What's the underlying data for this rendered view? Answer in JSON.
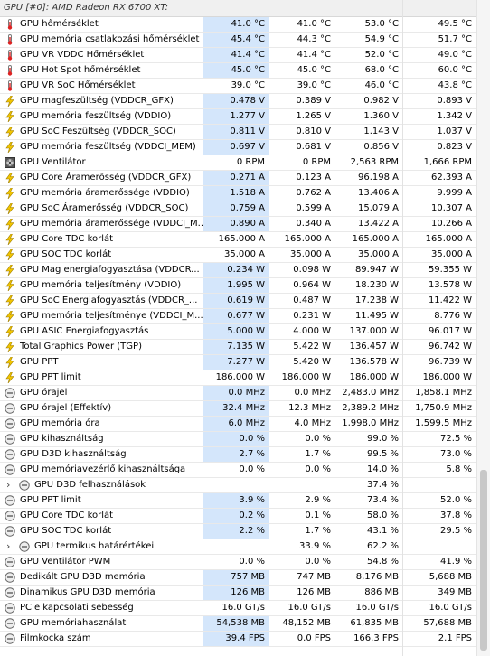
{
  "header": {
    "title": "GPU [#0]: AMD Radeon RX 6700 XT:"
  },
  "rows": [
    {
      "icon": "thermometer-icon",
      "label": "GPU hőmérséklet",
      "cur": "41.0 °C",
      "min": "41.0 °C",
      "max": "53.0 °C",
      "avg": "49.5 °C",
      "hl": true
    },
    {
      "icon": "thermometer-icon",
      "label": "GPU memória csatlakozási hőmérséklet",
      "cur": "45.4 °C",
      "min": "44.3 °C",
      "max": "54.9 °C",
      "avg": "51.7 °C",
      "hl": true
    },
    {
      "icon": "thermometer-icon",
      "label": "GPU VR VDDC Hőmérséklet",
      "cur": "41.4 °C",
      "min": "41.4 °C",
      "max": "52.0 °C",
      "avg": "49.0 °C",
      "hl": true
    },
    {
      "icon": "thermometer-icon",
      "label": "GPU Hot Spot hőmérséklet",
      "cur": "45.0 °C",
      "min": "45.0 °C",
      "max": "68.0 °C",
      "avg": "60.0 °C",
      "hl": true
    },
    {
      "icon": "thermometer-icon",
      "label": "GPU VR SoC Hőmérséklet",
      "cur": "39.0 °C",
      "min": "39.0 °C",
      "max": "46.0 °C",
      "avg": "43.8 °C",
      "hl": false
    },
    {
      "icon": "lightning-icon",
      "label": "GPU magfeszültség (VDDCR_GFX)",
      "cur": "0.478 V",
      "min": "0.389 V",
      "max": "0.982 V",
      "avg": "0.893 V",
      "hl": true
    },
    {
      "icon": "lightning-icon",
      "label": "GPU memória feszültség (VDDIO)",
      "cur": "1.277 V",
      "min": "1.265 V",
      "max": "1.360 V",
      "avg": "1.342 V",
      "hl": true
    },
    {
      "icon": "lightning-icon",
      "label": "GPU SoC Feszültség (VDDCR_SOC)",
      "cur": "0.811 V",
      "min": "0.810 V",
      "max": "1.143 V",
      "avg": "1.037 V",
      "hl": true
    },
    {
      "icon": "lightning-icon",
      "label": "GPU memória feszültség (VDDCI_MEM)",
      "cur": "0.697 V",
      "min": "0.681 V",
      "max": "0.856 V",
      "avg": "0.823 V",
      "hl": true
    },
    {
      "icon": "fan-icon",
      "label": "GPU Ventilátor",
      "cur": "0 RPM",
      "min": "0 RPM",
      "max": "2,563 RPM",
      "avg": "1,666 RPM",
      "hl": false
    },
    {
      "icon": "lightning-icon",
      "label": "GPU Core Áramerősség (VDDCR_GFX)",
      "cur": "0.271 A",
      "min": "0.123 A",
      "max": "96.198 A",
      "avg": "62.393 A",
      "hl": true
    },
    {
      "icon": "lightning-icon",
      "label": "GPU memória áramerőssége (VDDIO)",
      "cur": "1.518 A",
      "min": "0.762 A",
      "max": "13.406 A",
      "avg": "9.999 A",
      "hl": true
    },
    {
      "icon": "lightning-icon",
      "label": "GPU SoC Áramerősség (VDDCR_SOC)",
      "cur": "0.759 A",
      "min": "0.599 A",
      "max": "15.079 A",
      "avg": "10.307 A",
      "hl": true
    },
    {
      "icon": "lightning-icon",
      "label": "GPU memória áramerőssége (VDDCI_M...",
      "cur": "0.890 A",
      "min": "0.340 A",
      "max": "13.422 A",
      "avg": "10.266 A",
      "hl": true
    },
    {
      "icon": "lightning-icon",
      "label": "GPU Core TDC korlát",
      "cur": "165.000 A",
      "min": "165.000 A",
      "max": "165.000 A",
      "avg": "165.000 A",
      "hl": false
    },
    {
      "icon": "lightning-icon",
      "label": "GPU SOC TDC korlát",
      "cur": "35.000 A",
      "min": "35.000 A",
      "max": "35.000 A",
      "avg": "35.000 A",
      "hl": false
    },
    {
      "icon": "lightning-icon",
      "label": "GPU Mag energiafogyasztása (VDDCR...",
      "cur": "0.234 W",
      "min": "0.098 W",
      "max": "89.947 W",
      "avg": "59.355 W",
      "hl": true
    },
    {
      "icon": "lightning-icon",
      "label": "GPU memória teljesítmény (VDDIO)",
      "cur": "1.995 W",
      "min": "0.964 W",
      "max": "18.230 W",
      "avg": "13.578 W",
      "hl": true
    },
    {
      "icon": "lightning-icon",
      "label": "GPU SoC Energiafogyasztás (VDDCR_...",
      "cur": "0.619 W",
      "min": "0.487 W",
      "max": "17.238 W",
      "avg": "11.422 W",
      "hl": true
    },
    {
      "icon": "lightning-icon",
      "label": "GPU memória teljesítménye (VDDCI_M...",
      "cur": "0.677 W",
      "min": "0.231 W",
      "max": "11.495 W",
      "avg": "8.776 W",
      "hl": true
    },
    {
      "icon": "lightning-icon",
      "label": "GPU ASIC Energiafogyasztás",
      "cur": "5.000 W",
      "min": "4.000 W",
      "max": "137.000 W",
      "avg": "96.017 W",
      "hl": true
    },
    {
      "icon": "lightning-icon",
      "label": "Total Graphics Power (TGP)",
      "cur": "7.135 W",
      "min": "5.422 W",
      "max": "136.457 W",
      "avg": "96.742 W",
      "hl": true
    },
    {
      "icon": "lightning-icon",
      "label": "GPU PPT",
      "cur": "7.277 W",
      "min": "5.420 W",
      "max": "136.578 W",
      "avg": "96.739 W",
      "hl": true
    },
    {
      "icon": "lightning-icon",
      "label": "GPU PPT limit",
      "cur": "186.000 W",
      "min": "186.000 W",
      "max": "186.000 W",
      "avg": "186.000 W",
      "hl": false
    },
    {
      "icon": "clock-icon",
      "label": "GPU órajel",
      "cur": "0.0 MHz",
      "min": "0.0 MHz",
      "max": "2,483.0 MHz",
      "avg": "1,858.1 MHz",
      "hl": true
    },
    {
      "icon": "clock-icon",
      "label": "GPU órajel (Effektív)",
      "cur": "32.4 MHz",
      "min": "12.3 MHz",
      "max": "2,389.2 MHz",
      "avg": "1,750.9 MHz",
      "hl": true
    },
    {
      "icon": "clock-icon",
      "label": "GPU memória óra",
      "cur": "6.0 MHz",
      "min": "4.0 MHz",
      "max": "1,998.0 MHz",
      "avg": "1,599.5 MHz",
      "hl": true
    },
    {
      "icon": "clock-icon",
      "label": "GPU kihasználtság",
      "cur": "0.0 %",
      "min": "0.0 %",
      "max": "99.0 %",
      "avg": "72.5 %",
      "hl": true
    },
    {
      "icon": "clock-icon",
      "label": "GPU D3D kihasználtság",
      "cur": "2.7 %",
      "min": "1.7 %",
      "max": "99.5 %",
      "avg": "73.0 %",
      "hl": true
    },
    {
      "icon": "clock-icon",
      "label": "GPU memóriavezérlő kihasználtsága",
      "cur": "0.0 %",
      "min": "0.0 %",
      "max": "14.0 %",
      "avg": "5.8 %",
      "hl": false
    },
    {
      "group": true,
      "label": "GPU D3D felhasználások",
      "cur": "",
      "min": "",
      "max": "37.4 %",
      "avg": "",
      "hl": false
    },
    {
      "icon": "clock-icon",
      "label": "GPU PPT limit",
      "cur": "3.9 %",
      "min": "2.9 %",
      "max": "73.4 %",
      "avg": "52.0 %",
      "hl": true
    },
    {
      "icon": "clock-icon",
      "label": "GPU Core TDC korlát",
      "cur": "0.2 %",
      "min": "0.1 %",
      "max": "58.0 %",
      "avg": "37.8 %",
      "hl": true
    },
    {
      "icon": "clock-icon",
      "label": "GPU SOC TDC korlát",
      "cur": "2.2 %",
      "min": "1.7 %",
      "max": "43.1 %",
      "avg": "29.5 %",
      "hl": true
    },
    {
      "group": true,
      "label": "GPU termikus határértékei",
      "cur": "",
      "min": "33.9 %",
      "max": "62.2 %",
      "avg": "",
      "hl": false
    },
    {
      "icon": "clock-icon",
      "label": "GPU Ventilátor PWM",
      "cur": "0.0 %",
      "min": "0.0 %",
      "max": "54.8 %",
      "avg": "41.9 %",
      "hl": false
    },
    {
      "icon": "clock-icon",
      "label": "Dedikált GPU D3D memória",
      "cur": "757 MB",
      "min": "747 MB",
      "max": "8,176 MB",
      "avg": "5,688 MB",
      "hl": true
    },
    {
      "icon": "clock-icon",
      "label": "Dinamikus GPU D3D memória",
      "cur": "126 MB",
      "min": "126 MB",
      "max": "886 MB",
      "avg": "349 MB",
      "hl": true
    },
    {
      "icon": "clock-icon",
      "label": "PCIe kapcsolati sebesség",
      "cur": "16.0 GT/s",
      "min": "16.0 GT/s",
      "max": "16.0 GT/s",
      "avg": "16.0 GT/s",
      "hl": false
    },
    {
      "icon": "clock-icon",
      "label": "GPU memóriahasználat",
      "cur": "54,538 MB",
      "min": "48,152 MB",
      "max": "61,835 MB",
      "avg": "57,688 MB",
      "hl": true
    },
    {
      "icon": "clock-icon",
      "label": "Filmkocka szám",
      "cur": "39.4 FPS",
      "min": "0.0 FPS",
      "max": "166.3 FPS",
      "avg": "2.1 FPS",
      "hl": true
    }
  ]
}
